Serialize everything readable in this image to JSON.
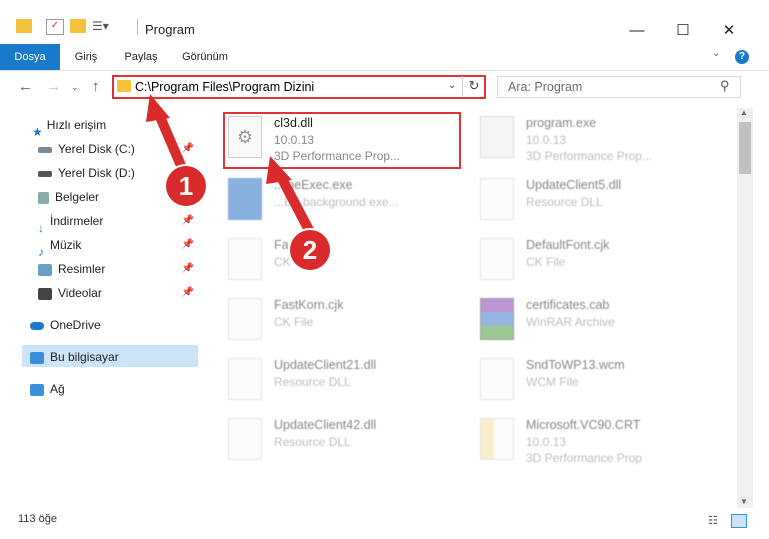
{
  "window": {
    "title": "Program"
  },
  "ribbon": {
    "tabs": [
      "Dosya",
      "Giriş",
      "Paylaş",
      "Görünüm"
    ],
    "help": "?"
  },
  "nav": {
    "address": "C:\\Program Files\\Program Dizini",
    "search_placeholder": "Ara: Program"
  },
  "sidebar": {
    "items": [
      {
        "label": "Hızlı erişim",
        "icon": "star-icon"
      },
      {
        "label": "Yerel Disk (C:)",
        "icon": "drive-icon",
        "pinned": true
      },
      {
        "label": "Yerel Disk (D:)",
        "icon": "drive-icon"
      },
      {
        "label": "Belgeler",
        "icon": "documents-icon"
      },
      {
        "label": "İndirmeler",
        "icon": "download-icon",
        "pinned": true
      },
      {
        "label": "Müzik",
        "icon": "music-icon",
        "pinned": true
      },
      {
        "label": "Resimler",
        "icon": "pictures-icon",
        "pinned": true
      },
      {
        "label": "Videolar",
        "icon": "video-icon",
        "pinned": true
      },
      {
        "label": "OneDrive",
        "icon": "cloud-icon"
      },
      {
        "label": "Bu bilgisayar",
        "icon": "computer-icon",
        "selected": true
      },
      {
        "label": "Ağ",
        "icon": "network-icon"
      }
    ]
  },
  "files": [
    {
      "name": "cl3d.dll",
      "l1": "10.0.13",
      "l2": "3D Performance Prop...",
      "highlight": true
    },
    {
      "name": "program.exe",
      "l1": "10.0.13",
      "l2": "3D Performance Prop..."
    },
    {
      "name": "...ineExec.exe",
      "l1": "...BY background exe...",
      "l2": ""
    },
    {
      "name": "UpdateClient5.dll",
      "l1": "Resource DLL",
      "l2": ""
    },
    {
      "name": "Fa...ch.cjk",
      "l1": "CK File",
      "l2": ""
    },
    {
      "name": "DefaultFont.cjk",
      "l1": "CK File",
      "l2": ""
    },
    {
      "name": "FastKorn.cjk",
      "l1": "CK File",
      "l2": ""
    },
    {
      "name": "certificates.cab",
      "l1": "WinRAR Archive",
      "l2": ""
    },
    {
      "name": "UpdateClient21.dll",
      "l1": "Resource DLL",
      "l2": ""
    },
    {
      "name": "SndToWP13.wcm",
      "l1": "WCM File",
      "l2": ""
    },
    {
      "name": "UpdateClient42.dll",
      "l1": "Resource DLL",
      "l2": ""
    },
    {
      "name": "Microsoft.VC90.CRT",
      "l1": "10.0.13",
      "l2": "3D Performance Prop"
    }
  ],
  "status": {
    "count": "113 öğe"
  },
  "callouts": [
    "1",
    "2"
  ],
  "colors": {
    "accent": "#1979ca",
    "highlight": "#e03434",
    "folder": "#f5c33b"
  }
}
